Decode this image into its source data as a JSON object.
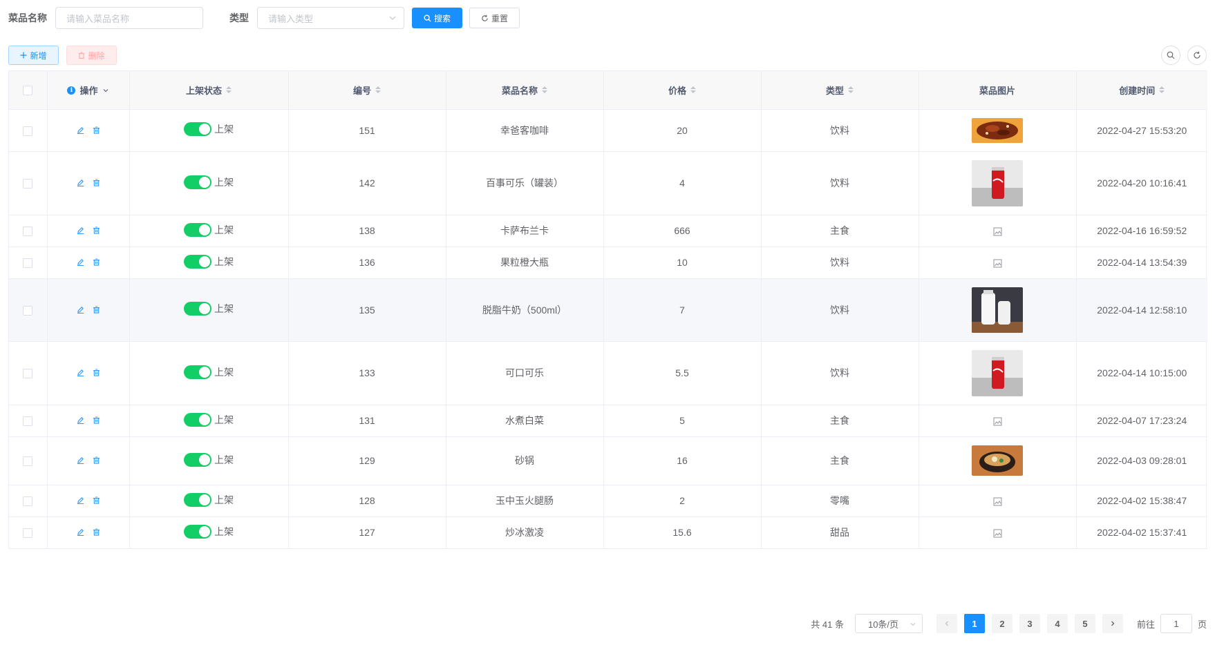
{
  "search": {
    "name_label": "菜品名称",
    "name_placeholder": "请输入菜品名称",
    "type_label": "类型",
    "type_placeholder": "请输入类型",
    "search_button": "搜索",
    "reset_button": "重置"
  },
  "toolbar": {
    "add_button": "新增",
    "delete_button": "删除"
  },
  "table": {
    "headers": {
      "actions": "操作",
      "status": "上架状态",
      "id": "编号",
      "name": "菜品名称",
      "price": "价格",
      "type": "类型",
      "image": "菜品图片",
      "created": "创建时间"
    },
    "rows": [
      {
        "status": "上架",
        "id": "151",
        "name": "幸爸客咖啡",
        "price": "20",
        "type": "饮料",
        "image": "food-stir-fry",
        "created": "2022-04-27 15:53:20"
      },
      {
        "status": "上架",
        "id": "142",
        "name": "百事可乐（罐装）",
        "price": "4",
        "type": "饮料",
        "image": "cola-can",
        "created": "2022-04-20 10:16:41"
      },
      {
        "status": "上架",
        "id": "138",
        "name": "卡萨布兰卡",
        "price": "666",
        "type": "主食",
        "image": "broken-image-icon",
        "created": "2022-04-16 16:59:52"
      },
      {
        "status": "上架",
        "id": "136",
        "name": "果粒橙大瓶",
        "price": "10",
        "type": "饮料",
        "image": "broken-image-icon",
        "created": "2022-04-14 13:54:39"
      },
      {
        "status": "上架",
        "id": "135",
        "name": "脱脂牛奶（500ml）",
        "price": "7",
        "type": "饮料",
        "image": "milk-bottles",
        "created": "2022-04-14 12:58:10"
      },
      {
        "status": "上架",
        "id": "133",
        "name": "可口可乐",
        "price": "5.5",
        "type": "饮料",
        "image": "cola-can",
        "created": "2022-04-14 10:15:00"
      },
      {
        "status": "上架",
        "id": "131",
        "name": "水煮白菜",
        "price": "5",
        "type": "主食",
        "image": "broken-image-icon",
        "created": "2022-04-07 17:23:24"
      },
      {
        "status": "上架",
        "id": "129",
        "name": "砂锅",
        "price": "16",
        "type": "主食",
        "image": "clay-pot",
        "created": "2022-04-03 09:28:01"
      },
      {
        "status": "上架",
        "id": "128",
        "name": "玉中玉火腿肠",
        "price": "2",
        "type": "零嘴",
        "image": "broken-image-icon",
        "created": "2022-04-02 15:38:47"
      },
      {
        "status": "上架",
        "id": "127",
        "name": "炒冰激凌",
        "price": "15.6",
        "type": "甜品",
        "image": "broken-image-icon",
        "created": "2022-04-02 15:37:41"
      }
    ]
  },
  "pagination": {
    "total": "共 41 条",
    "page_size": "10条/页",
    "pages": [
      "1",
      "2",
      "3",
      "4",
      "5"
    ],
    "current": "1",
    "goto_prefix": "前往",
    "goto_value": "1",
    "goto_suffix": "页"
  },
  "colors": {
    "primary": "#1890ff",
    "switch_on": "#13ce66",
    "danger_light": "#ffa4a4"
  }
}
